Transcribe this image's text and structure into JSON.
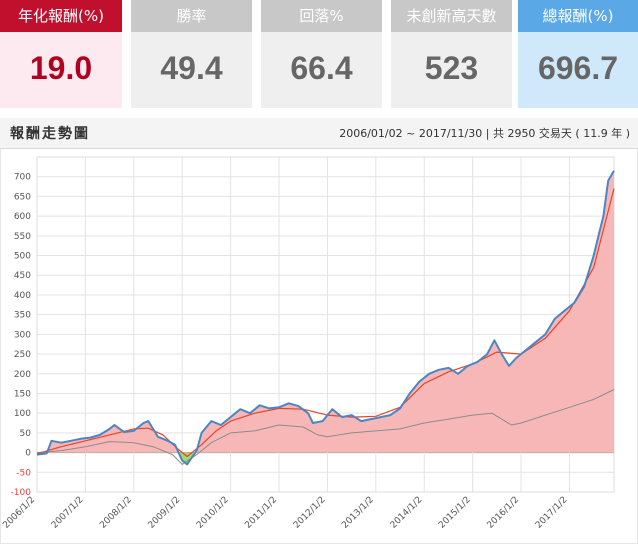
{
  "stats": [
    {
      "label": "年化報酬(%)",
      "value": "19.0",
      "header_color": "#c0102e",
      "body_color": "#fde9f0",
      "value_color": "#b00020"
    },
    {
      "label": "勝率",
      "value": "49.4",
      "header_color": "#c8c8c8",
      "body_color": "#efefef",
      "value_color": "#666666"
    },
    {
      "label": "回落%",
      "value": "66.4",
      "header_color": "#c8c8c8",
      "body_color": "#efefef",
      "value_color": "#666666"
    },
    {
      "label": "未創新高天數",
      "value": "523",
      "header_color": "#c8c8c8",
      "body_color": "#efefef",
      "value_color": "#666666"
    },
    {
      "label": "總報酬(%)",
      "value": "696.7",
      "header_color": "#5aa9e6",
      "body_color": "#cfe9fb",
      "value_color": "#666666"
    }
  ],
  "panel": {
    "title": "報酬走勢圖",
    "range": "2006/01/02 ~ 2017/11/30 | 共 2950 交易天 ( 11.9 年 )"
  },
  "chart_data": {
    "type": "area",
    "title": "",
    "xlabel": "",
    "ylabel": "",
    "ylim": [
      -100,
      750
    ],
    "yticks": [
      -100,
      -50,
      0,
      50,
      100,
      150,
      200,
      250,
      300,
      350,
      400,
      450,
      500,
      550,
      600,
      650,
      700
    ],
    "xlim": [
      2006.0,
      2017.92
    ],
    "x_ticks": [
      {
        "label": "2006/1/2",
        "x": 2006.0
      },
      {
        "label": "2007/1/2",
        "x": 2007.0
      },
      {
        "label": "2008/1/2",
        "x": 2008.0
      },
      {
        "label": "2009/1/2",
        "x": 2009.0
      },
      {
        "label": "2010/1/2",
        "x": 2010.0
      },
      {
        "label": "2011/1/2",
        "x": 2011.0
      },
      {
        "label": "2012/1/2",
        "x": 2012.0
      },
      {
        "label": "2013/1/2",
        "x": 2013.0
      },
      {
        "label": "2014/1/2",
        "x": 2014.0
      },
      {
        "label": "2015/1/2",
        "x": 2015.0
      },
      {
        "label": "2016/1/2",
        "x": 2016.0
      },
      {
        "label": "2017/1/2",
        "x": 2017.0
      }
    ],
    "grid": true,
    "colors": {
      "strategy": "#4a86c5",
      "trend": "#e8442a",
      "benchmark": "#8c8c8c",
      "fill_pos": "#f7b7b7",
      "fill_neg": "#a6d96a"
    },
    "series": [
      {
        "key": "strategy",
        "x": [
          2006.0,
          2006.2,
          2006.3,
          2006.5,
          2006.7,
          2006.9,
          2007.1,
          2007.3,
          2007.5,
          2007.6,
          2007.8,
          2008.0,
          2008.2,
          2008.3,
          2008.5,
          2008.7,
          2008.85,
          2009.0,
          2009.1,
          2009.3,
          2009.4,
          2009.6,
          2009.8,
          2010.0,
          2010.2,
          2010.4,
          2010.6,
          2010.8,
          2011.0,
          2011.2,
          2011.4,
          2011.6,
          2011.7,
          2011.9,
          2012.1,
          2012.3,
          2012.5,
          2012.7,
          2012.9,
          2013.1,
          2013.3,
          2013.5,
          2013.7,
          2013.9,
          2014.1,
          2014.3,
          2014.5,
          2014.7,
          2014.9,
          2015.1,
          2015.3,
          2015.45,
          2015.6,
          2015.75,
          2015.9,
          2016.1,
          2016.3,
          2016.5,
          2016.7,
          2016.9,
          2017.1,
          2017.3,
          2017.5,
          2017.6,
          2017.7,
          2017.8,
          2017.92
        ],
        "y": [
          -5,
          -2,
          30,
          25,
          30,
          35,
          38,
          45,
          60,
          70,
          52,
          55,
          75,
          80,
          40,
          30,
          20,
          -20,
          -30,
          5,
          50,
          80,
          70,
          90,
          110,
          100,
          120,
          112,
          115,
          125,
          118,
          100,
          75,
          80,
          110,
          90,
          95,
          80,
          85,
          90,
          95,
          112,
          150,
          180,
          200,
          210,
          215,
          200,
          220,
          230,
          250,
          285,
          250,
          220,
          240,
          260,
          280,
          300,
          340,
          360,
          380,
          420,
          500,
          550,
          600,
          690,
          715
        ]
      },
      {
        "key": "trend",
        "x": [
          2006.0,
          2006.5,
          2007.0,
          2007.5,
          2008.0,
          2008.3,
          2008.6,
          2008.9,
          2009.1,
          2009.4,
          2009.7,
          2010.0,
          2010.5,
          2011.0,
          2011.5,
          2012.0,
          2012.5,
          2013.0,
          2013.5,
          2014.0,
          2014.5,
          2015.0,
          2015.5,
          2016.0,
          2016.5,
          2017.0,
          2017.5,
          2017.92
        ],
        "y": [
          -3,
          15,
          30,
          45,
          60,
          62,
          45,
          10,
          -10,
          20,
          55,
          80,
          100,
          112,
          110,
          95,
          90,
          92,
          115,
          175,
          205,
          225,
          255,
          250,
          290,
          360,
          470,
          670
        ]
      },
      {
        "key": "benchmark",
        "x": [
          2006.0,
          2006.5,
          2007.0,
          2007.5,
          2008.0,
          2008.4,
          2008.8,
          2009.0,
          2009.3,
          2009.6,
          2010.0,
          2010.5,
          2011.0,
          2011.5,
          2011.8,
          2012.0,
          2012.5,
          2013.0,
          2013.5,
          2014.0,
          2014.5,
          2015.0,
          2015.4,
          2015.8,
          2016.0,
          2016.5,
          2017.0,
          2017.5,
          2017.92
        ],
        "y": [
          0,
          5,
          15,
          28,
          25,
          15,
          -5,
          -30,
          -5,
          25,
          50,
          55,
          70,
          65,
          45,
          40,
          50,
          55,
          60,
          75,
          85,
          95,
          100,
          70,
          75,
          95,
          115,
          135,
          160
        ]
      }
    ]
  }
}
